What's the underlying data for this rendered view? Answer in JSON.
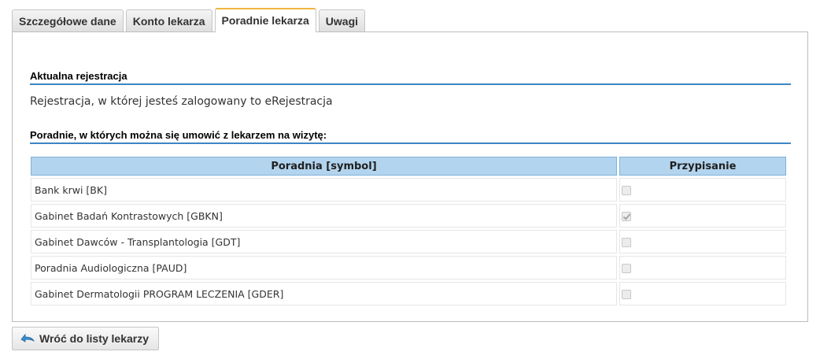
{
  "tabs": [
    {
      "label": "Szczegółowe dane"
    },
    {
      "label": "Konto lekarza"
    },
    {
      "label": "Poradnie lekarza"
    },
    {
      "label": "Uwagi"
    }
  ],
  "active_tab": "Poradnie lekarza",
  "registration": {
    "heading": "Aktualna rejestracja",
    "text": "Rejestracja, w której jesteś zalogowany to eRejestracja"
  },
  "clinics": {
    "heading": "Poradnie, w których można się umowić z lekarzem na wizytę:",
    "columns": [
      "Poradnia [symbol]",
      "Przypisanie"
    ],
    "rows": [
      {
        "name": "Bank krwi [BK]",
        "assigned": false
      },
      {
        "name": "Gabinet Badań Kontrastowych [GBKN]",
        "assigned": true
      },
      {
        "name": "Gabinet Dawców - Transplantologia [GDT]",
        "assigned": false
      },
      {
        "name": "Poradnia Audiologiczna [PAUD]",
        "assigned": false
      },
      {
        "name": "Gabinet Dermatologii PROGRAM LECZENIA [GDER]",
        "assigned": false
      }
    ]
  },
  "back_button": {
    "label": "Wróć do listy lekarzy",
    "icon": "back-arrow-icon"
  },
  "colors": {
    "accent": "#3c86c4",
    "header_bg": "#b3d4ee",
    "active_tab_top": "#f0b43e"
  }
}
